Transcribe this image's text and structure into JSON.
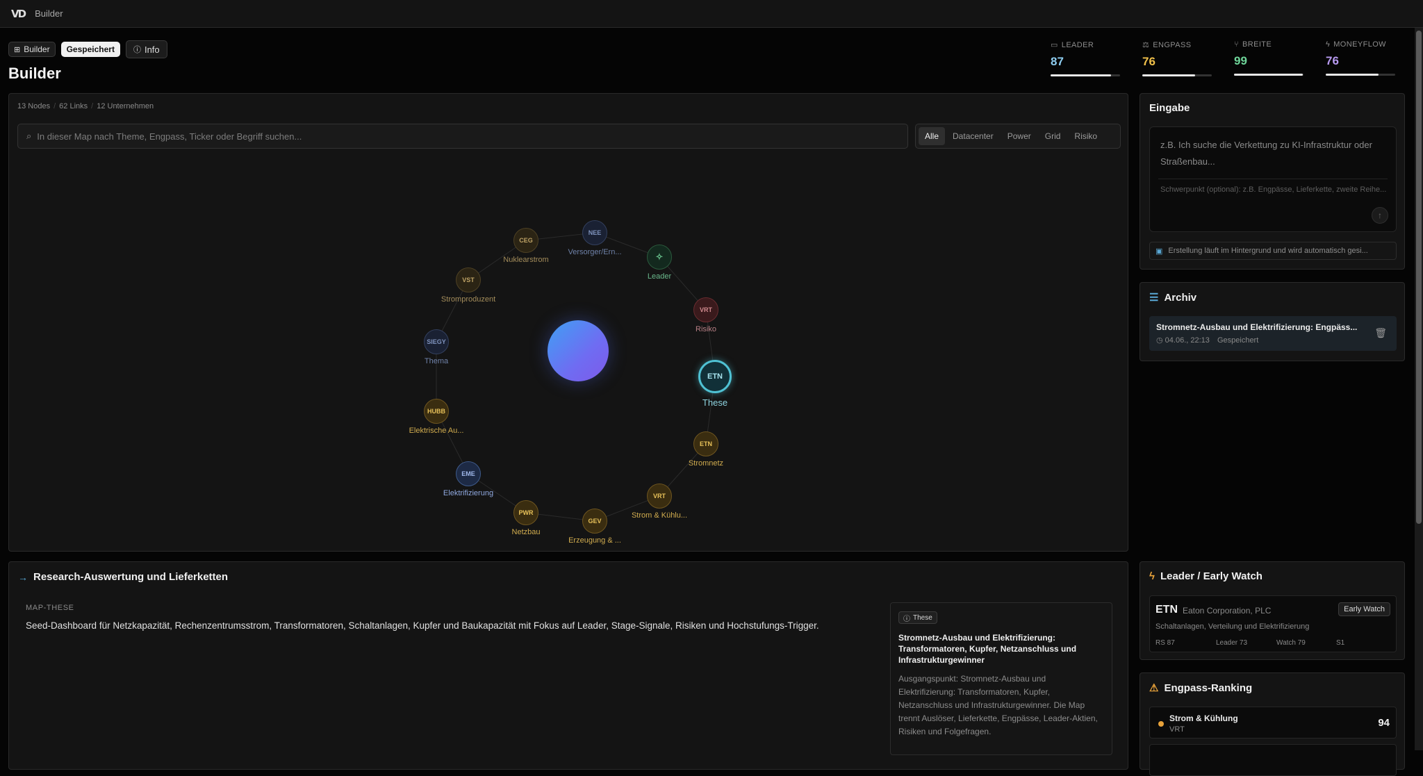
{
  "topbar": {
    "logo": "VD",
    "app_name": "Builder"
  },
  "header": {
    "pills": {
      "builder": "Builder",
      "saved": "Gespeichert",
      "info": "Info"
    },
    "title": "Builder"
  },
  "metrics": [
    {
      "label": "LEADER",
      "value": "87",
      "progress": 0.87,
      "color": "#8ecdf0",
      "icon": "folder-icon"
    },
    {
      "label": "ENGPASS",
      "value": "76",
      "progress": 0.76,
      "color": "#f0c04a",
      "icon": "scale-icon"
    },
    {
      "label": "BREITE",
      "value": "99",
      "progress": 0.99,
      "color": "#6fd69a",
      "icon": "branch-icon"
    },
    {
      "label": "MONEYFLOW",
      "value": "76",
      "progress": 0.76,
      "color": "#b79af0",
      "icon": "bolt-icon"
    }
  ],
  "map": {
    "stats": {
      "nodes": "13 Nodes",
      "links": "62 Links",
      "companies": "12 Unternehmen"
    },
    "search_placeholder": "In dieser Map nach Theme, Engpass, Ticker oder Begriff suchen...",
    "filters": [
      "Alle",
      "Datacenter",
      "Power",
      "Grid",
      "Risiko"
    ],
    "active_filter": "Alle",
    "nodes": [
      {
        "ticker": "NEE",
        "label": "Versorger/Ern...",
        "style": "blue-dim"
      },
      {
        "ticker": "✧",
        "label": "Leader",
        "style": "green"
      },
      {
        "ticker": "VRT",
        "label": "Risiko",
        "style": "red"
      },
      {
        "ticker": "ETN",
        "label": "These",
        "style": "these"
      },
      {
        "ticker": "ETN",
        "label": "Stromnetz",
        "style": "gold"
      },
      {
        "ticker": "VRT",
        "label": "Strom & Kühlu...",
        "style": "gold"
      },
      {
        "ticker": "GEV",
        "label": "Erzeugung & ...",
        "style": "gold"
      },
      {
        "ticker": "PWR",
        "label": "Netzbau",
        "style": "gold"
      },
      {
        "ticker": "EME",
        "label": "Elektrifizierung",
        "style": "blue"
      },
      {
        "ticker": "HUBB",
        "label": "Elektrische Au...",
        "style": "gold"
      },
      {
        "ticker": "SIEGY",
        "label": "Thema",
        "style": "blue-dim"
      },
      {
        "ticker": "VST",
        "label": "Stromproduzent",
        "style": "gold-dim"
      },
      {
        "ticker": "CEG",
        "label": "Nuklearstrom",
        "style": "gold-dim"
      }
    ]
  },
  "input_panel": {
    "title": "Eingabe",
    "placeholder": "z.B. Ich suche die Verkettung zu KI-Infrastruktur oder Straßenbau...",
    "focus_placeholder": "Schwerpunkt (optional): z.B. Engpässe, Lieferkette, zweite Reihe...",
    "background_note": "Erstellung läuft im Hintergrund und wird automatisch gesi..."
  },
  "archive": {
    "title": "Archiv",
    "items": [
      {
        "title": "Stromnetz-Ausbau und Elektrifizierung: Engpäss...",
        "date": "04.06., 22:13",
        "status": "Gespeichert"
      }
    ]
  },
  "research": {
    "title": "Research-Auswertung und Lieferketten",
    "map_label": "MAP-THESE",
    "map_text": "Seed-Dashboard für Netzkapazität, Rechenzentrumsstrom, Transformatoren, Schaltanlagen, Kupfer und Baukapazität mit Fokus auf Leader, Stage-Signale, Risiken und Hochstufungs-Trigger.",
    "thesis": {
      "badge": "These",
      "title": "Stromnetz-Ausbau und Elektrifizierung: Transformatoren, Kupfer, Netzanschluss und Infrastrukturgewinner",
      "description": "Ausgangspunkt: Stromnetz-Ausbau und Elektrifizierung: Transformatoren, Kupfer, Netzanschluss und Infrastrukturgewinner. Die Map trennt Auslöser, Lieferkette, Engpässe, Leader-Aktien, Risiken und Folgefragen."
    }
  },
  "leader_panel": {
    "title": "Leader / Early Watch",
    "card": {
      "ticker": "ETN",
      "company": "Eaton Corporation, PLC",
      "badge": "Early Watch",
      "subtitle": "Schaltanlagen, Verteilung und Elektrifizierung",
      "stats": [
        "RS 87",
        "Leader 73",
        "Watch 79",
        "S1"
      ]
    }
  },
  "engpass_panel": {
    "title": "Engpass-Ranking",
    "items": [
      {
        "name": "Strom & Kühlung",
        "ticker": "VRT",
        "score": "94"
      }
    ]
  }
}
